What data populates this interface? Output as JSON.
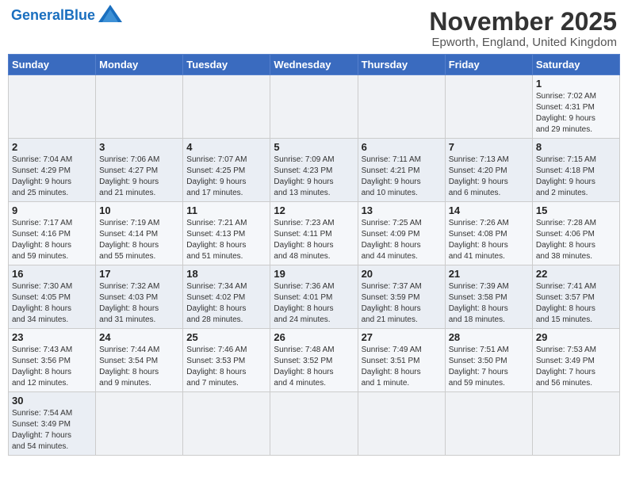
{
  "header": {
    "logo_general": "General",
    "logo_blue": "Blue",
    "month_title": "November 2025",
    "location": "Epworth, England, United Kingdom"
  },
  "weekdays": [
    "Sunday",
    "Monday",
    "Tuesday",
    "Wednesday",
    "Thursday",
    "Friday",
    "Saturday"
  ],
  "weeks": [
    [
      {
        "day": "",
        "info": ""
      },
      {
        "day": "",
        "info": ""
      },
      {
        "day": "",
        "info": ""
      },
      {
        "day": "",
        "info": ""
      },
      {
        "day": "",
        "info": ""
      },
      {
        "day": "",
        "info": ""
      },
      {
        "day": "1",
        "info": "Sunrise: 7:02 AM\nSunset: 4:31 PM\nDaylight: 9 hours\nand 29 minutes."
      }
    ],
    [
      {
        "day": "2",
        "info": "Sunrise: 7:04 AM\nSunset: 4:29 PM\nDaylight: 9 hours\nand 25 minutes."
      },
      {
        "day": "3",
        "info": "Sunrise: 7:06 AM\nSunset: 4:27 PM\nDaylight: 9 hours\nand 21 minutes."
      },
      {
        "day": "4",
        "info": "Sunrise: 7:07 AM\nSunset: 4:25 PM\nDaylight: 9 hours\nand 17 minutes."
      },
      {
        "day": "5",
        "info": "Sunrise: 7:09 AM\nSunset: 4:23 PM\nDaylight: 9 hours\nand 13 minutes."
      },
      {
        "day": "6",
        "info": "Sunrise: 7:11 AM\nSunset: 4:21 PM\nDaylight: 9 hours\nand 10 minutes."
      },
      {
        "day": "7",
        "info": "Sunrise: 7:13 AM\nSunset: 4:20 PM\nDaylight: 9 hours\nand 6 minutes."
      },
      {
        "day": "8",
        "info": "Sunrise: 7:15 AM\nSunset: 4:18 PM\nDaylight: 9 hours\nand 2 minutes."
      }
    ],
    [
      {
        "day": "9",
        "info": "Sunrise: 7:17 AM\nSunset: 4:16 PM\nDaylight: 8 hours\nand 59 minutes."
      },
      {
        "day": "10",
        "info": "Sunrise: 7:19 AM\nSunset: 4:14 PM\nDaylight: 8 hours\nand 55 minutes."
      },
      {
        "day": "11",
        "info": "Sunrise: 7:21 AM\nSunset: 4:13 PM\nDaylight: 8 hours\nand 51 minutes."
      },
      {
        "day": "12",
        "info": "Sunrise: 7:23 AM\nSunset: 4:11 PM\nDaylight: 8 hours\nand 48 minutes."
      },
      {
        "day": "13",
        "info": "Sunrise: 7:25 AM\nSunset: 4:09 PM\nDaylight: 8 hours\nand 44 minutes."
      },
      {
        "day": "14",
        "info": "Sunrise: 7:26 AM\nSunset: 4:08 PM\nDaylight: 8 hours\nand 41 minutes."
      },
      {
        "day": "15",
        "info": "Sunrise: 7:28 AM\nSunset: 4:06 PM\nDaylight: 8 hours\nand 38 minutes."
      }
    ],
    [
      {
        "day": "16",
        "info": "Sunrise: 7:30 AM\nSunset: 4:05 PM\nDaylight: 8 hours\nand 34 minutes."
      },
      {
        "day": "17",
        "info": "Sunrise: 7:32 AM\nSunset: 4:03 PM\nDaylight: 8 hours\nand 31 minutes."
      },
      {
        "day": "18",
        "info": "Sunrise: 7:34 AM\nSunset: 4:02 PM\nDaylight: 8 hours\nand 28 minutes."
      },
      {
        "day": "19",
        "info": "Sunrise: 7:36 AM\nSunset: 4:01 PM\nDaylight: 8 hours\nand 24 minutes."
      },
      {
        "day": "20",
        "info": "Sunrise: 7:37 AM\nSunset: 3:59 PM\nDaylight: 8 hours\nand 21 minutes."
      },
      {
        "day": "21",
        "info": "Sunrise: 7:39 AM\nSunset: 3:58 PM\nDaylight: 8 hours\nand 18 minutes."
      },
      {
        "day": "22",
        "info": "Sunrise: 7:41 AM\nSunset: 3:57 PM\nDaylight: 8 hours\nand 15 minutes."
      }
    ],
    [
      {
        "day": "23",
        "info": "Sunrise: 7:43 AM\nSunset: 3:56 PM\nDaylight: 8 hours\nand 12 minutes."
      },
      {
        "day": "24",
        "info": "Sunrise: 7:44 AM\nSunset: 3:54 PM\nDaylight: 8 hours\nand 9 minutes."
      },
      {
        "day": "25",
        "info": "Sunrise: 7:46 AM\nSunset: 3:53 PM\nDaylight: 8 hours\nand 7 minutes."
      },
      {
        "day": "26",
        "info": "Sunrise: 7:48 AM\nSunset: 3:52 PM\nDaylight: 8 hours\nand 4 minutes."
      },
      {
        "day": "27",
        "info": "Sunrise: 7:49 AM\nSunset: 3:51 PM\nDaylight: 8 hours\nand 1 minute."
      },
      {
        "day": "28",
        "info": "Sunrise: 7:51 AM\nSunset: 3:50 PM\nDaylight: 7 hours\nand 59 minutes."
      },
      {
        "day": "29",
        "info": "Sunrise: 7:53 AM\nSunset: 3:49 PM\nDaylight: 7 hours\nand 56 minutes."
      }
    ],
    [
      {
        "day": "30",
        "info": "Sunrise: 7:54 AM\nSunset: 3:49 PM\nDaylight: 7 hours\nand 54 minutes."
      },
      {
        "day": "",
        "info": ""
      },
      {
        "day": "",
        "info": ""
      },
      {
        "day": "",
        "info": ""
      },
      {
        "day": "",
        "info": ""
      },
      {
        "day": "",
        "info": ""
      },
      {
        "day": "",
        "info": ""
      }
    ]
  ]
}
